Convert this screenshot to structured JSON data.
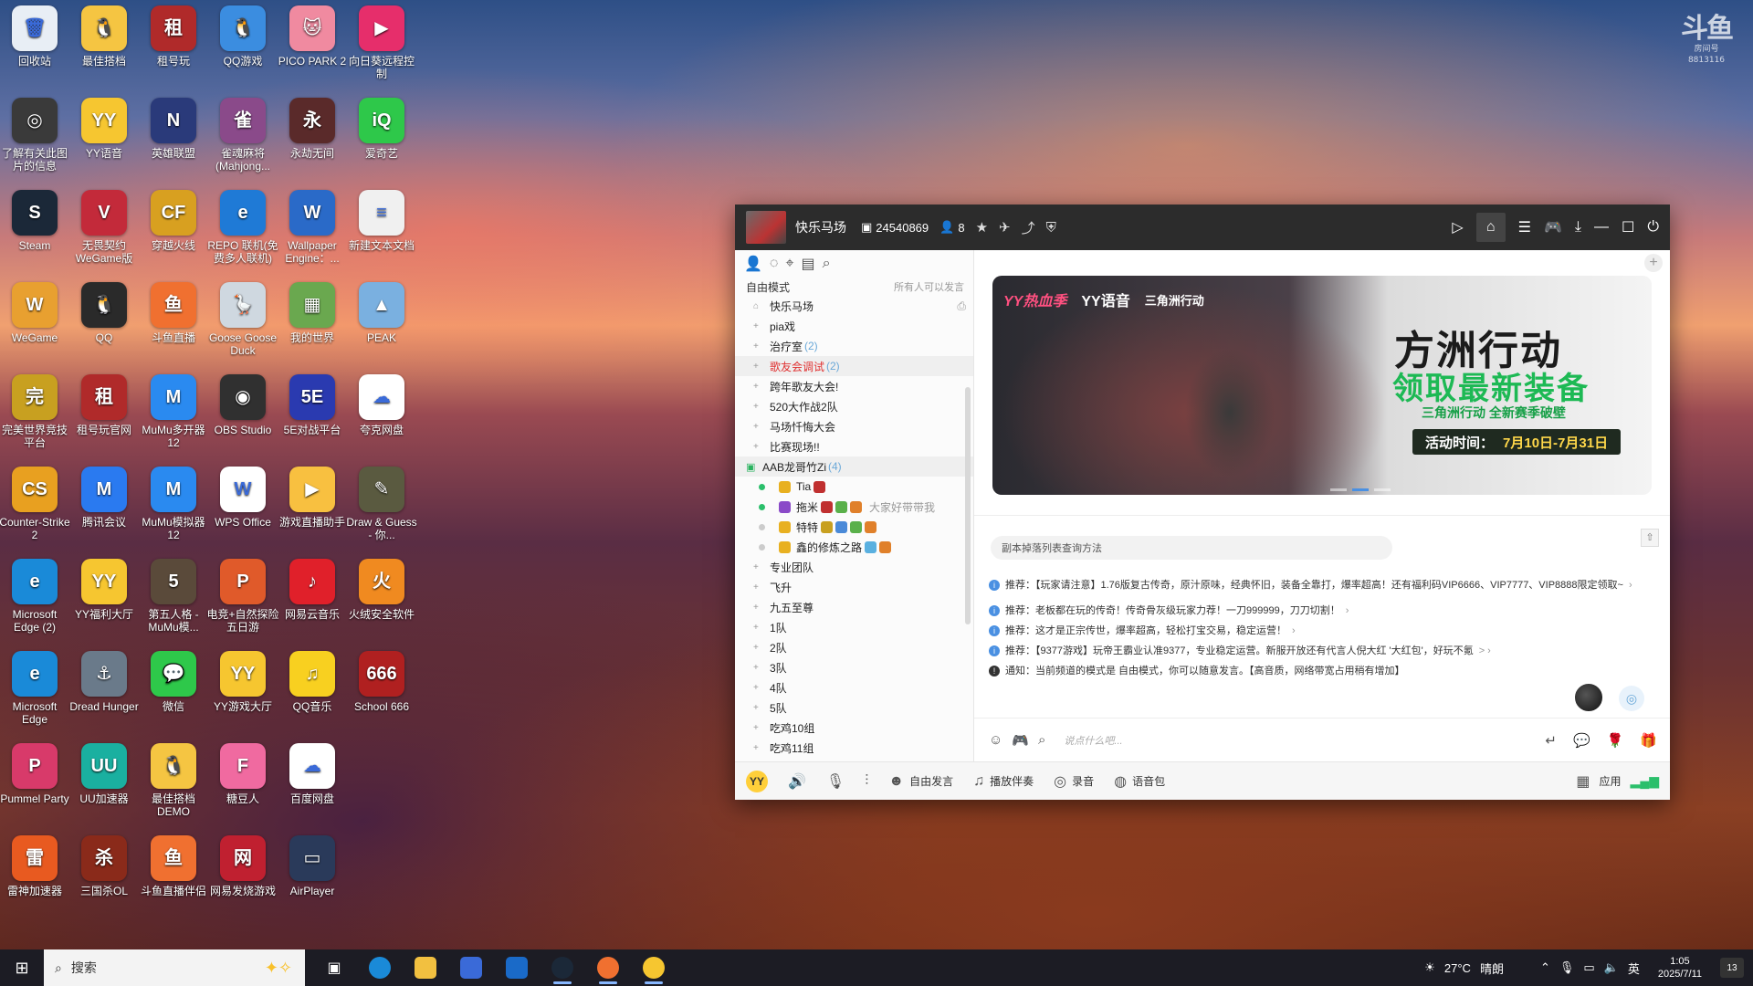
{
  "watermark": {
    "logo": "斗鱼",
    "sub": "房间号",
    "room": "8813116"
  },
  "desktop_icons": [
    {
      "label": "回收站",
      "color": "#e8eef5",
      "icon": "recycle-bin-icon",
      "glyph": "🗑"
    },
    {
      "label": "最佳搭档",
      "color": "#f5c542",
      "icon": "penguin-icon",
      "glyph": "🐧"
    },
    {
      "label": "租号玩",
      "color": "#b02a2a",
      "icon": "zuhaowan-icon",
      "glyph": "租"
    },
    {
      "label": "QQ游戏",
      "color": "#3b8de0",
      "icon": "qq-game-icon",
      "glyph": "🐧"
    },
    {
      "label": "PICO PARK 2",
      "color": "#f08aa0",
      "icon": "pico-park-icon",
      "glyph": "🐱"
    },
    {
      "label": "向日葵远程控制",
      "color": "#e62e6b",
      "icon": "sunlogin-icon",
      "glyph": "▶"
    },
    {
      "label": "了解有关此图片的信息",
      "color": "#3a3a3a",
      "icon": "camera-info-icon",
      "glyph": "◎"
    },
    {
      "label": "YY语音",
      "color": "#f6c630",
      "icon": "yy-voice-icon",
      "glyph": "YY"
    },
    {
      "label": "英雄联盟",
      "color": "#2a3a7a",
      "icon": "lol-icon",
      "glyph": "N"
    },
    {
      "label": "雀魂麻将(Mahjong...",
      "color": "#8a4a8a",
      "icon": "mahjong-soul-icon",
      "glyph": "雀"
    },
    {
      "label": "永劫无间",
      "color": "#5a2a2a",
      "icon": "naraka-icon",
      "glyph": "永"
    },
    {
      "label": "爱奇艺",
      "color": "#2ec84a",
      "icon": "iqiyi-icon",
      "glyph": "iQ"
    },
    {
      "label": "Steam",
      "color": "#1b2838",
      "icon": "steam-icon",
      "glyph": "S"
    },
    {
      "label": "无畏契约 WeGame版",
      "color": "#c32a3a",
      "icon": "valorant-icon",
      "glyph": "V"
    },
    {
      "label": "穿越火线",
      "color": "#d8a020",
      "icon": "crossfire-icon",
      "glyph": "CF"
    },
    {
      "label": "REPO 联机(免费多人联机)",
      "color": "#1f7ad6",
      "icon": "ie-icon",
      "glyph": "e"
    },
    {
      "label": "Wallpaper Engine：...",
      "color": "#2a6ac8",
      "icon": "wallpaper-engine-icon",
      "glyph": "W"
    },
    {
      "label": "新建文本文档",
      "color": "#f0f0f0",
      "icon": "text-file-icon",
      "glyph": "≡"
    },
    {
      "label": "WeGame",
      "color": "#e8a030",
      "icon": "wegame-icon",
      "glyph": "W"
    },
    {
      "label": "QQ",
      "color": "#2a2a2a",
      "icon": "qq-icon",
      "glyph": "🐧"
    },
    {
      "label": "斗鱼直播",
      "color": "#f07030",
      "icon": "douyu-icon",
      "glyph": "鱼"
    },
    {
      "label": "Goose Goose Duck",
      "color": "#cfd8e0",
      "icon": "goose-icon",
      "glyph": "🪿"
    },
    {
      "label": "我的世界",
      "color": "#6aa84f",
      "icon": "minecraft-icon",
      "glyph": "▦"
    },
    {
      "label": "PEAK",
      "color": "#7ab0e0",
      "icon": "peak-icon",
      "glyph": "▲"
    },
    {
      "label": "完美世界竞技平台",
      "color": "#c8a020",
      "icon": "perfect-world-icon",
      "glyph": "完"
    },
    {
      "label": "租号玩官网",
      "color": "#b02a2a",
      "icon": "zuhaowan-site-icon",
      "glyph": "租"
    },
    {
      "label": "MuMu多开器12",
      "color": "#2a8af0",
      "icon": "mumu-multi-icon",
      "glyph": "M"
    },
    {
      "label": "OBS Studio",
      "color": "#303030",
      "icon": "obs-icon",
      "glyph": "◉"
    },
    {
      "label": "5E对战平台",
      "color": "#2a3ab0",
      "icon": "5e-icon",
      "glyph": "5E"
    },
    {
      "label": "夸克网盘",
      "color": "#ffffff",
      "icon": "quark-icon",
      "glyph": "☁"
    },
    {
      "label": "Counter-Strike 2",
      "color": "#e8a020",
      "icon": "cs2-icon",
      "glyph": "CS"
    },
    {
      "label": "腾讯会议",
      "color": "#2a7af0",
      "icon": "tencent-meeting-icon",
      "glyph": "M"
    },
    {
      "label": "MuMu模拟器12",
      "color": "#2a8af0",
      "icon": "mumu-icon",
      "glyph": "M"
    },
    {
      "label": "WPS Office",
      "color": "#ffffff",
      "icon": "wps-icon",
      "glyph": "W"
    },
    {
      "label": "游戏直播助手",
      "color": "#f8c040",
      "icon": "live-helper-icon",
      "glyph": "▶"
    },
    {
      "label": "Draw & Guess - 你...",
      "color": "#5a5a40",
      "icon": "draw-guess-icon",
      "glyph": "✎"
    },
    {
      "label": "Microsoft Edge (2)",
      "color": "#1a8ad8",
      "icon": "edge-icon",
      "glyph": "e"
    },
    {
      "label": "YY福利大厅",
      "color": "#f6c630",
      "icon": "yy-welfare-icon",
      "glyph": "YY"
    },
    {
      "label": "第五人格 -MuMu模...",
      "color": "#5a4a3a",
      "icon": "identity-v-icon",
      "glyph": "5"
    },
    {
      "label": "电竞+自然探险五日游",
      "color": "#e05a2a",
      "icon": "ppt-file-icon",
      "glyph": "P"
    },
    {
      "label": "网易云音乐",
      "color": "#e0202a",
      "icon": "netease-music-icon",
      "glyph": "♪"
    },
    {
      "label": "火绒安全软件",
      "color": "#f08a20",
      "icon": "huorong-icon",
      "glyph": "火"
    },
    {
      "label": "Microsoft Edge",
      "color": "#1a8ad8",
      "icon": "edge-icon",
      "glyph": "e"
    },
    {
      "label": "Dread Hunger",
      "color": "#6a7a8a",
      "icon": "dread-hunger-icon",
      "glyph": "⚓"
    },
    {
      "label": "微信",
      "color": "#2ec84a",
      "icon": "wechat-icon",
      "glyph": "💬"
    },
    {
      "label": "YY游戏大厅",
      "color": "#f6c630",
      "icon": "yy-games-icon",
      "glyph": "YY"
    },
    {
      "label": "QQ音乐",
      "color": "#f8d020",
      "icon": "qq-music-icon",
      "glyph": "♫"
    },
    {
      "label": "School 666",
      "color": "#b02020",
      "icon": "school-666-icon",
      "glyph": "666"
    },
    {
      "label": "Pummel Party",
      "color": "#d83a6a",
      "icon": "pummel-party-icon",
      "glyph": "P"
    },
    {
      "label": "UU加速器",
      "color": "#1ab0a0",
      "icon": "uu-booster-icon",
      "glyph": "UU"
    },
    {
      "label": "最佳搭档 DEMO",
      "color": "#f5c542",
      "icon": "penguin-demo-icon",
      "glyph": "🐧"
    },
    {
      "label": "糖豆人",
      "color": "#f06aa0",
      "icon": "fall-guys-icon",
      "glyph": "F"
    },
    {
      "label": "百度网盘",
      "color": "#ffffff",
      "icon": "baidu-disk-icon",
      "glyph": "☁"
    },
    {
      "label": "",
      "color": "",
      "icon": "",
      "glyph": ""
    },
    {
      "label": "雷神加速器",
      "color": "#e85a20",
      "icon": "leishen-icon",
      "glyph": "雷"
    },
    {
      "label": "三国杀OL",
      "color": "#8a2a1a",
      "icon": "sanguosha-icon",
      "glyph": "杀"
    },
    {
      "label": "斗鱼直播伴侣",
      "color": "#f07030",
      "icon": "douyu-companion-icon",
      "glyph": "鱼"
    },
    {
      "label": "网易发烧游戏",
      "color": "#c02030",
      "icon": "netease-fever-icon",
      "glyph": "网"
    },
    {
      "label": "AirPlayer",
      "color": "#2a3a5a",
      "icon": "airplayer-icon",
      "glyph": "▭"
    }
  ],
  "window": {
    "title": "快乐马场",
    "channel_id": "24540869",
    "online_count": "8",
    "mode": "自由模式",
    "mode_hint": "所有人可以发言",
    "channels": [
      {
        "name": "快乐马场",
        "count": "",
        "type": "root"
      },
      {
        "name": "pia戏",
        "count": "",
        "type": "normal"
      },
      {
        "name": "治疗室",
        "count": "(2)",
        "type": "normal"
      },
      {
        "name": "歌友会调试",
        "count": "(2)",
        "type": "red"
      },
      {
        "name": "跨年歌友大会!",
        "count": "",
        "type": "normal"
      },
      {
        "name": "520大作战2队",
        "count": "",
        "type": "normal"
      },
      {
        "name": "马场忏悔大会",
        "count": "",
        "type": "normal"
      },
      {
        "name": "比赛现场!!",
        "count": "",
        "type": "normal"
      }
    ],
    "group": {
      "name": "AAB龙哥竹Zi",
      "count": "(4)"
    },
    "users": [
      {
        "name": "Tia",
        "online": true,
        "sig": ""
      },
      {
        "name": "拖米",
        "online": true,
        "sig": "大家好带带我"
      },
      {
        "name": "特特",
        "online": false,
        "sig": ""
      },
      {
        "name": "鑫的修炼之路",
        "online": false,
        "sig": ""
      }
    ],
    "more_channels": [
      "专业团队",
      "飞升",
      "九五至尊",
      "1队",
      "2队",
      "3队",
      "4队",
      "5队",
      "吃鸡10组",
      "吃鸡11组"
    ],
    "banner": {
      "brand1": "YY热血季",
      "brand2": "YY语音",
      "brand3": "三角洲行动",
      "headline": "方洲行动",
      "subheadline": "领取最新装备",
      "tagline": "三角洲行动 全新赛季破壁",
      "period_label": "活动时间：",
      "period": "7月10日-7月31日"
    },
    "quick_query": "副本掉落列表查询方法",
    "messages": [
      {
        "kind": "info",
        "text": "推荐：【玩家请注意】1.76版复古传奇，原汁原味，经典怀旧，装备全靠打，爆率超高！还有福利码VIP6666、VIP7777、VIP8888限定领取~",
        "link": "›"
      },
      {
        "kind": "info",
        "text": "推荐：老板都在玩的传奇！传奇骨灰级玩家力荐！一刀999999，刀刀切割！",
        "link": "›"
      },
      {
        "kind": "info",
        "text": "推荐：这才是正宗传世，爆率超高，轻松打宝交易，稳定运营！",
        "link": "›"
      },
      {
        "kind": "info",
        "text": "推荐：【9377游戏】玩帝王霸业认准9377，专业稳定运营。新服开放还有代言人倪大红 '大红包'，好玩不氪",
        "link": "> ›"
      },
      {
        "kind": "notice",
        "text": "通知：当前频道的模式是 自由模式，你可以随意发言。【高音质，网络带宽占用稍有增加】",
        "link": ""
      }
    ],
    "input_placeholder": "说点什么吧...",
    "bottom_bar": {
      "free_speak": "自由发言",
      "music": "播放伴奏",
      "record": "录音",
      "voice_pack": "语音包",
      "apps": "应用"
    }
  },
  "taskbar": {
    "search_placeholder": "搜索",
    "weather_temp": "27°C",
    "weather_text": "晴朗",
    "ime": "英",
    "time": "1:05",
    "date": "2025/7/11",
    "notifications": "13"
  }
}
